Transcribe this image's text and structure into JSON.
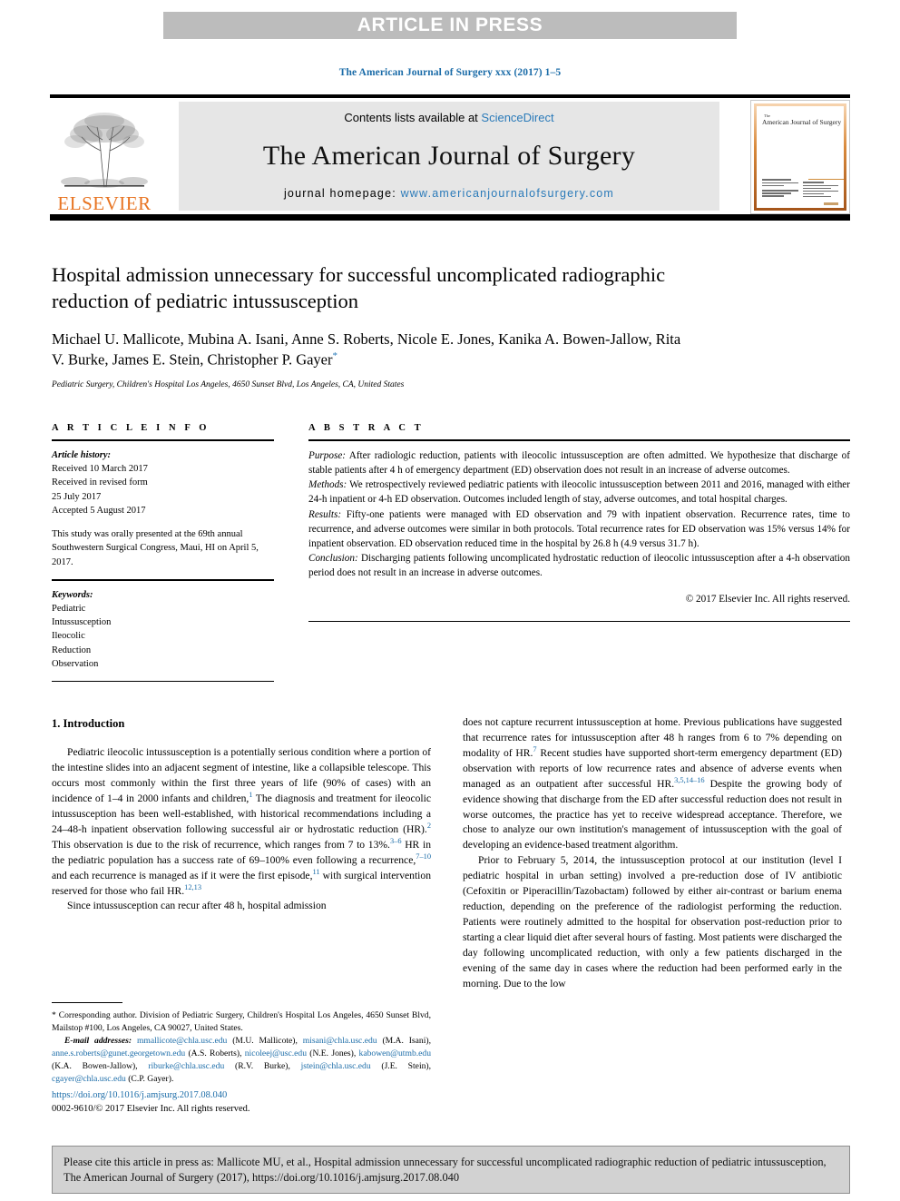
{
  "banner": {
    "label": "ARTICLE IN PRESS",
    "background": "#bcbcbc",
    "text_color": "#ffffff"
  },
  "running_head": "The American Journal of Surgery xxx (2017) 1–5",
  "masthead": {
    "publisher_logo_word": "ELSEVIER",
    "publisher_color": "#e87422",
    "contents_prefix": "Contents lists available at ",
    "contents_link": "ScienceDirect",
    "journal_title": "The American Journal of Surgery",
    "homepage_prefix": "journal homepage: ",
    "homepage_url": "www.americanjournalofsurgery.com",
    "link_color": "#2a7ab9",
    "cover_title_small": "The",
    "cover_title_main": "American Journal of Surgery"
  },
  "article": {
    "title": "Hospital admission unnecessary for successful uncomplicated radiographic reduction of pediatric intussusception",
    "authors": "Michael U. Mallicote, Mubina A. Isani, Anne S. Roberts, Nicole E. Jones, Kanika A. Bowen-Jallow, Rita V. Burke, James E. Stein, Christopher P. Gayer",
    "corresponding_marker": "*",
    "affiliation": "Pediatric Surgery, Children's Hospital Los Angeles, 4650 Sunset Blvd, Los Angeles, CA, United States"
  },
  "info": {
    "heading": "A R T I C L E   I N F O",
    "history_label": "Article history:",
    "history_lines": [
      "Received 10 March 2017",
      "Received in revised form",
      "25 July 2017",
      "Accepted 5 August 2017"
    ],
    "note": "This study was orally presented at the 69th annual Southwestern Surgical Congress, Maui, HI on April 5, 2017.",
    "keywords_label": "Keywords:",
    "keywords": [
      "Pediatric",
      "Intussusception",
      "Ileocolic",
      "Reduction",
      "Observation"
    ]
  },
  "abstract": {
    "heading": "A B S T R A C T",
    "sections": [
      {
        "label": "Purpose:",
        "text": " After radiologic reduction, patients with ileocolic intussusception are often admitted. We hypothesize that discharge of stable patients after 4 h of emergency department (ED) observation does not result in an increase of adverse outcomes."
      },
      {
        "label": "Methods:",
        "text": " We retrospectively reviewed pediatric patients with ileocolic intussusception between 2011 and 2016, managed with either 24-h inpatient or 4-h ED observation. Outcomes included length of stay, adverse outcomes, and total hospital charges."
      },
      {
        "label": "Results:",
        "text": " Fifty-one patients were managed with ED observation and 79 with inpatient observation. Recurrence rates, time to recurrence, and adverse outcomes were similar in both protocols. Total recurrence rates for ED observation was 15% versus 14% for inpatient observation. ED observation reduced time in the hospital by 26.8 h (4.9 versus 31.7 h)."
      },
      {
        "label": "Conclusion:",
        "text": " Discharging patients following uncomplicated hydrostatic reduction of ileocolic intussusception after a 4-h observation period does not result in an increase in adverse outcomes."
      }
    ],
    "copyright": "© 2017 Elsevier Inc. All rights reserved."
  },
  "body": {
    "section_number_title": "1. Introduction",
    "left_paragraphs": [
      "Pediatric ileocolic intussusception is a potentially serious condition where a portion of the intestine slides into an adjacent segment of intestine, like a collapsible telescope. This occurs most commonly within the first three years of life (90% of cases) with an incidence of 1–4 in 2000 infants and children,",
      " The diagnosis and treatment for ileocolic intussusception has been well-established, with historical recommendations including a 24–48-h inpatient observation following successful air or hydrostatic reduction (HR).",
      " This observation is due to the risk of recurrence, which ranges from 7 to 13%.",
      " HR in the pediatric population has a success rate of 69–100% even following a recurrence,",
      " and each recurrence is managed as if it were the first episode,",
      " with surgical intervention reserved for those who fail HR.",
      "Since intussusception can recur after 48 h, hospital admission"
    ],
    "left_refs": [
      "1",
      "2",
      "3–6",
      "7–10",
      "11",
      "12,13"
    ],
    "right_paragraphs": [
      "does not capture recurrent intussusception at home. Previous publications have suggested that recurrence rates for intussusception after 48 h ranges from 6 to 7% depending on modality of HR.",
      " Recent studies have supported short-term emergency department (ED) observation with reports of low recurrence rates and absence of adverse events when managed as an outpatient after successful HR.",
      " Despite the growing body of evidence showing that discharge from the ED after successful reduction does not result in worse outcomes, the practice has yet to receive widespread acceptance. Therefore, we chose to analyze our own institution's management of intussusception with the goal of developing an evidence-based treatment algorithm.",
      "Prior to February 5, 2014, the intussusception protocol at our institution (level I pediatric hospital in urban setting) involved a pre-reduction dose of IV antibiotic (Cefoxitin or Piperacillin/Tazobactam) followed by either air-contrast or barium enema reduction, depending on the preference of the radiologist performing the reduction. Patients were routinely admitted to the hospital for observation post-reduction prior to starting a clear liquid diet after several hours of fasting. Most patients were discharged the day following uncomplicated reduction, with only a few patients discharged in the evening of the same day in cases where the reduction had been performed early in the morning. Due to the low"
    ],
    "right_refs": [
      "7",
      "3,5,14–16"
    ]
  },
  "footnotes": {
    "corresponding": "* Corresponding author. Division of Pediatric Surgery, Children's Hospital Los Angeles, 4650 Sunset Blvd, Mailstop #100, Los Angeles, CA 90027, United States.",
    "email_label": "E-mail addresses:",
    "emails": [
      {
        "address": "mmallicote@chla.usc.edu",
        "owner": "(M.U. Mallicote)"
      },
      {
        "address": "misani@chla.usc.edu",
        "owner": "(M.A. Isani)"
      },
      {
        "address": "anne.s.roberts@gunet.georgetown.edu",
        "owner": "(A.S. Roberts)"
      },
      {
        "address": "nicoleej@usc.edu",
        "owner": "(N.E. Jones)"
      },
      {
        "address": "kabowen@utmb.edu",
        "owner": "(K.A. Bowen-Jallow)"
      },
      {
        "address": "riburke@chla.usc.edu",
        "owner": "(R.V. Burke)"
      },
      {
        "address": "jstein@chla.usc.edu",
        "owner": "(J.E. Stein)"
      },
      {
        "address": "cgayer@chla.usc.edu",
        "owner": "(C.P. Gayer)"
      }
    ],
    "doi": "https://doi.org/10.1016/j.amjsurg.2017.08.040",
    "issn_line": "0002-9610/© 2017 Elsevier Inc. All rights reserved."
  },
  "cite_box": {
    "text": "Please cite this article in press as: Mallicote MU, et al., Hospital admission unnecessary for successful uncomplicated radiographic reduction of pediatric intussusception, The American Journal of Surgery (2017), https://doi.org/10.1016/j.amjsurg.2017.08.040"
  }
}
